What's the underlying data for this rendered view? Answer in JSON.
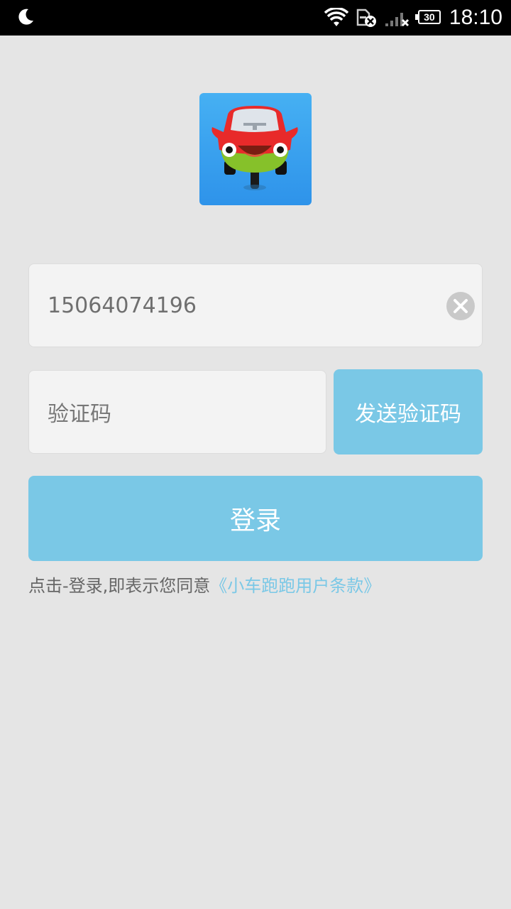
{
  "status_bar": {
    "time": "18:10",
    "battery": "30",
    "icons": [
      "moon-icon",
      "wifi-icon",
      "sim-error-icon",
      "signal-icon",
      "battery-icon"
    ]
  },
  "logo": {
    "icon": "car-mascot-icon"
  },
  "form": {
    "phone_value": "15064074196",
    "code_placeholder": "验证码",
    "send_code_label": "发送验证码",
    "login_label": "登录"
  },
  "terms": {
    "prefix": "点击-登录,即表示您同意",
    "link": "《小车跑跑用户条款》"
  },
  "colors": {
    "background": "#e5e5e5",
    "accent": "#7ac8e6",
    "field_bg": "#f3f3f3",
    "logo_bg": "#3aa2ee"
  }
}
